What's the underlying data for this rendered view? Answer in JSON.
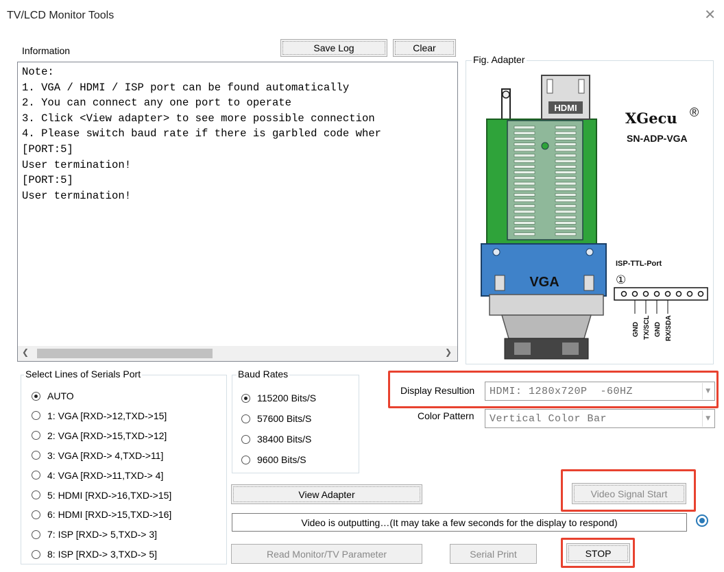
{
  "window": {
    "title": "TV/LCD Monitor Tools",
    "close_glyph": "✕"
  },
  "info": {
    "label": "Information",
    "save_log": "Save Log",
    "clear": "Clear",
    "lines": [
      "Note:",
      "1. VGA / HDMI / ISP port can be found automatically",
      "2. You can connect any one port to operate",
      "3. Click <View adapter> to see more possible connection",
      "4. Please switch baud rate if there is garbled code wher",
      "[PORT:5]",
      "User termination!",
      "[PORT:5]",
      "User termination!"
    ]
  },
  "adapter_fig": {
    "legend": "Fig. Adapter",
    "brand": "XGecu",
    "registered": "®",
    "model": "SN-ADP-VGA",
    "hdmi_label": "HDMI",
    "vga_label": "VGA",
    "isp_label": "ISP-TTL-Port",
    "pin_one": "①",
    "pins": [
      "GND",
      "TX/SCL",
      "GND",
      "RX/SDA"
    ]
  },
  "serial_lines": {
    "legend": "Select Lines of Serials Port",
    "selected": "AUTO",
    "options": [
      "AUTO",
      "1: VGA [RXD->12,TXD->15]",
      "2: VGA [RXD->15,TXD->12]",
      "3: VGA [RXD-> 4,TXD->11]",
      "4: VGA [RXD->11,TXD-> 4]",
      "5: HDMI [RXD->16,TXD->15]",
      "6: HDMI [RXD->15,TXD->16]",
      "7: ISP [RXD-> 5,TXD-> 3]",
      "8: ISP [RXD-> 3,TXD-> 5]"
    ]
  },
  "baud": {
    "legend": "Baud Rates",
    "selected": "115200 Bits/S",
    "options": [
      "115200 Bits/S",
      "57600 Bits/S",
      "38400 Bits/S",
      "9600 Bits/S"
    ]
  },
  "display": {
    "resolution_label": "Display Resultion",
    "resolution_value": "HDMI: 1280x720P  -60HZ",
    "pattern_label": "Color Pattern",
    "pattern_value": "Vertical Color Bar"
  },
  "buttons": {
    "view_adapter": "View Adapter",
    "video_start": "Video Signal Start",
    "read_param": "Read Monitor/TV Parameter",
    "serial_print": "Serial Print",
    "stop": "STOP"
  },
  "status": {
    "text": "Video is outputting…(It may take a few seconds for the display to respond)"
  },
  "colors": {
    "highlight": "#e8422f",
    "pcb_green": "#2fa33a",
    "vga_blue": "#3f82c9"
  }
}
